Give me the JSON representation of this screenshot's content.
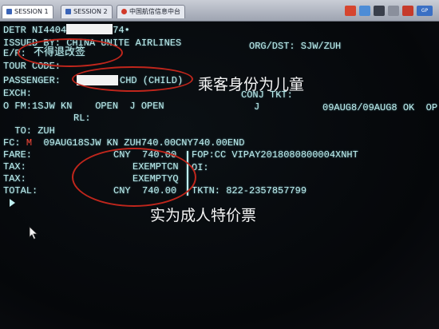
{
  "tabs": [
    {
      "label": "SESSION 1"
    },
    {
      "label": "SESSION 2"
    },
    {
      "label": "中国航信信息中台"
    }
  ],
  "toolbar": {
    "badge_label": "GP"
  },
  "terminal": {
    "line1": "DETR NI4404",
    "line1_tail": "74•",
    "issued_by": "ISSUED BY: CHINA UNITE AIRLINES",
    "org_dst": "ORG/DST: SJW/ZUH",
    "er_label": "E/R:",
    "er_value": "不得退改签",
    "tour_code": "TOUR CODE:",
    "passenger_label": "PASSENGER:",
    "passenger_type": "CHD (CHILD)",
    "exch": "EXCH:",
    "conj": "CONJ TKT:",
    "fm_line": "O FM:1SJW KN    OPEN  J OPEN",
    "j_col": "J",
    "dates": "09AUG8/09AUG8 OK  OP",
    "rl": "RL:",
    "to": "  TO: ZUH",
    "fc_label": "FC:",
    "fc_mark": "M",
    "fc_value": "09AUG18SJW KN ZUH740.00CNY740.00END",
    "fare_label": "FARE:",
    "fare_value": "CNY  740.00",
    "fop": "FOP:CC VIPAY2018080800004XNHT",
    "tax1_label": "TAX:",
    "tax1_value": "EXEMPTCN",
    "oi": "OI:",
    "tax2_label": "TAX:",
    "tax2_value": "EXEMPTYQ",
    "total_label": "TOTAL:",
    "total_value": "CNY  740.00",
    "tkt": "TKTN: 822-2357857799"
  },
  "annotations": {
    "child_identity": "乘客身份为儿童",
    "adult_price": "实为成人特价票"
  },
  "colors": {
    "terminal_text": "#bfeff0",
    "annotation_circle": "#c0261c",
    "background": "#05060a"
  }
}
